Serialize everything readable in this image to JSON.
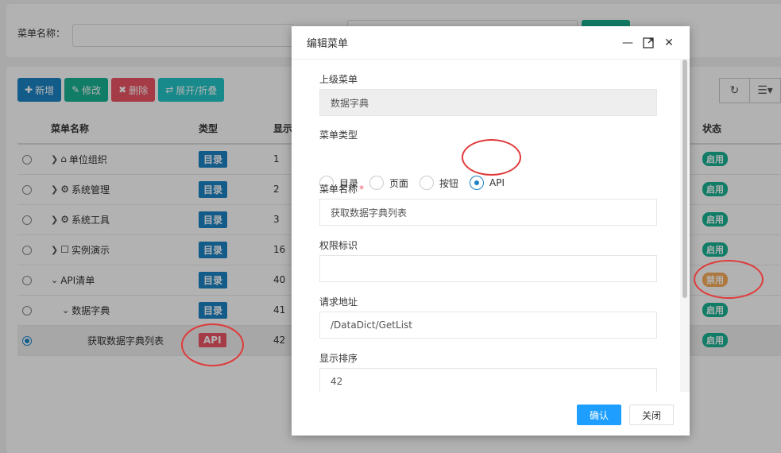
{
  "search": {
    "label": "菜单名称："
  },
  "toolbar": {
    "add": "新增",
    "edit": "修改",
    "delete": "删除",
    "expand": "展开/折叠"
  },
  "table": {
    "headers": {
      "name": "菜单名称",
      "type": "类型",
      "order": "显示",
      "status": "状态"
    },
    "rows": [
      {
        "name": "单位组织",
        "type": "目录",
        "order": "1",
        "status": "启用"
      },
      {
        "name": "系统管理",
        "type": "目录",
        "order": "2",
        "status": "启用"
      },
      {
        "name": "系统工具",
        "type": "目录",
        "order": "3",
        "status": "启用"
      },
      {
        "name": "实例演示",
        "type": "目录",
        "order": "16",
        "status": "启用"
      },
      {
        "name": "API清单",
        "type": "目录",
        "order": "40",
        "status": "禁用"
      },
      {
        "name": "数据字典",
        "type": "目录",
        "order": "41",
        "status": "启用"
      },
      {
        "name": "获取数据字典列表",
        "type": "API",
        "order": "42",
        "status": "启用"
      }
    ]
  },
  "modal": {
    "title": "编辑菜单",
    "parent_label": "上级菜单",
    "parent_value": "数据字典",
    "type_label": "菜单类型",
    "type_options": [
      "目录",
      "页面",
      "按钮",
      "API"
    ],
    "type_selected": "API",
    "name_label": "菜单名称",
    "name_value": "获取数据字典列表",
    "perm_label": "权限标识",
    "perm_value": "",
    "url_label": "请求地址",
    "url_value": "/DataDict/GetList",
    "order_label": "显示排序",
    "order_value": "42",
    "ok": "确认",
    "close": "关闭"
  },
  "colors": {
    "primary": "#1c84c6",
    "success": "#1ab394",
    "danger": "#ed5565",
    "warning": "#f8ac59",
    "confirm": "#1e9fff"
  }
}
